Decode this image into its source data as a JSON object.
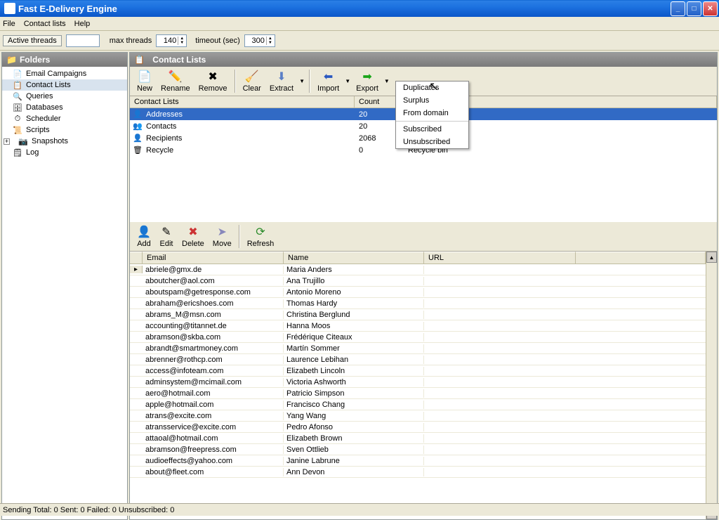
{
  "window": {
    "title": "Fast E-Delivery Engine"
  },
  "menu": {
    "file": "File",
    "contacts": "Contact lists",
    "help": "Help"
  },
  "threads": {
    "active_label": "Active threads",
    "max_label": "max threads",
    "max_value": "140",
    "timeout_label": "timeout (sec)",
    "timeout_value": "300"
  },
  "sidebar": {
    "title": "Folders",
    "items": [
      {
        "label": "Email Campaigns",
        "icon": "📄"
      },
      {
        "label": "Contact Lists",
        "icon": "📋",
        "selected": true
      },
      {
        "label": "Queries",
        "icon": "🔍"
      },
      {
        "label": "Databases",
        "icon": "🗄"
      },
      {
        "label": "Scheduler",
        "icon": "⏱"
      },
      {
        "label": "Scripts",
        "icon": "📜"
      },
      {
        "label": "Snapshots",
        "icon": "📷",
        "hasplus": true
      },
      {
        "label": "Log",
        "icon": "🗒"
      }
    ]
  },
  "rightpanel": {
    "title": "Contact Lists"
  },
  "toolbar1": {
    "new": "New",
    "rename": "Rename",
    "remove": "Remove",
    "clear": "Clear",
    "extract": "Extract",
    "import": "Import",
    "export": "Export"
  },
  "extract_menu": {
    "duplicates": "Duplicates",
    "surplus": "Surplus",
    "from_domain": "From domain",
    "subscribed": "Subscribed",
    "unsubscribed": "Unsubscribed"
  },
  "clist": {
    "headers": {
      "name": "Contact Lists",
      "count": "Count",
      "comments": "Comments"
    },
    "rows": [
      {
        "name": "Addresses",
        "count": "20",
        "comments": "",
        "icon": "👤",
        "selected": true
      },
      {
        "name": "Contacts",
        "count": "20",
        "comments": "",
        "icon": "👥"
      },
      {
        "name": "Recipients",
        "count": "2068",
        "comments": "",
        "icon": "👤"
      },
      {
        "name": "Recycle",
        "count": "0",
        "comments": "Recycle bin",
        "icon": "🗑"
      }
    ]
  },
  "toolbar2": {
    "add": "Add",
    "edit": "Edit",
    "delete": "Delete",
    "move": "Move",
    "refresh": "Refresh"
  },
  "egrid": {
    "headers": {
      "email": "Email",
      "name": "Name",
      "url": "URL"
    },
    "rows": [
      {
        "email": "abriele@gmx.de",
        "name": "Maria Anders",
        "url": "",
        "current": true
      },
      {
        "email": "aboutcher@aol.com",
        "name": "Ana Trujillo",
        "url": ""
      },
      {
        "email": "aboutspam@getresponse.com",
        "name": "Antonio Moreno",
        "url": ""
      },
      {
        "email": "abraham@ericshoes.com",
        "name": "Thomas Hardy",
        "url": ""
      },
      {
        "email": "abrams_M@msn.com",
        "name": "Christina Berglund",
        "url": ""
      },
      {
        "email": "accounting@titannet.de",
        "name": "Hanna Moos",
        "url": ""
      },
      {
        "email": "abramson@skba.com",
        "name": "Frédérique Citeaux",
        "url": ""
      },
      {
        "email": "abrandt@smartmoney.com",
        "name": "Martín Sommer",
        "url": ""
      },
      {
        "email": "abrenner@rothcp.com",
        "name": "Laurence Lebihan",
        "url": ""
      },
      {
        "email": "access@infoteam.com",
        "name": "Elizabeth Lincoln",
        "url": ""
      },
      {
        "email": "adminsystem@mcimail.com",
        "name": "Victoria Ashworth",
        "url": ""
      },
      {
        "email": "aero@hotmail.com",
        "name": "Patricio Simpson",
        "url": ""
      },
      {
        "email": "apple@hotmail.com",
        "name": "Francisco Chang",
        "url": ""
      },
      {
        "email": "atrans@excite.com",
        "name": "Yang Wang",
        "url": ""
      },
      {
        "email": "atransservice@excite.com",
        "name": "Pedro Afonso",
        "url": ""
      },
      {
        "email": "attaoal@hotmail.com",
        "name": "Elizabeth Brown",
        "url": ""
      },
      {
        "email": "abramson@freepress.com",
        "name": "Sven Ottlieb",
        "url": ""
      },
      {
        "email": "audioeffects@yahoo.com",
        "name": "Janine Labrune",
        "url": ""
      },
      {
        "email": "about@fleet.com",
        "name": "Ann Devon",
        "url": ""
      }
    ]
  },
  "status": {
    "text": "Sending  Total: 0  Sent: 0  Failed: 0  Unsubscribed: 0"
  }
}
